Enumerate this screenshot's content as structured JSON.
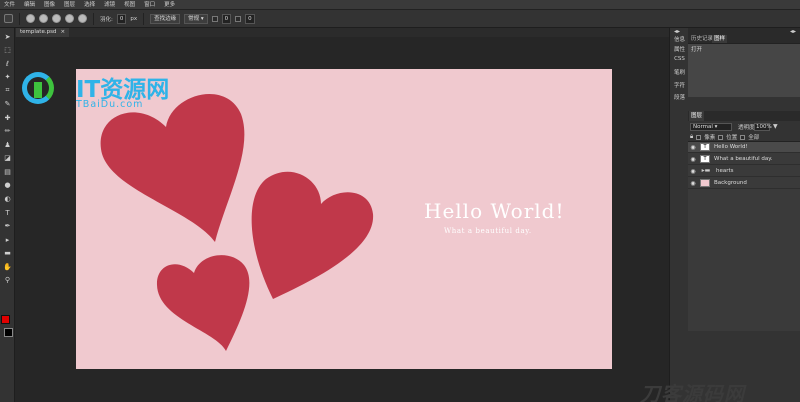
{
  "menu": [
    "文件",
    "编辑",
    "图像",
    "图层",
    "选择",
    "滤镜",
    "视图",
    "窗口",
    "更多"
  ],
  "options": {
    "feather_label": "羽化:",
    "feather_value": "0",
    "feather_unit": "px",
    "refine_button": "查找边缘",
    "style_select": "常规",
    "width_value": "0",
    "height_value": "0"
  },
  "document": {
    "tab_title": "template.psd",
    "tab_close": "×"
  },
  "canvas": {
    "background_color": "#f0c9cf",
    "heart_color": "#c0384a",
    "headline": "Hello World!",
    "subline": "What a beautiful day."
  },
  "logo": {
    "title": "IT资源网",
    "site": "TBaiDu.com"
  },
  "side_column": [
    "信息",
    "属性",
    "CSS",
    "笔刷",
    "字符",
    "段落"
  ],
  "history_panel": {
    "tabs": [
      "历史记录",
      "图样"
    ],
    "active_tab": "图样",
    "items": [
      "打开"
    ]
  },
  "layers_panel": {
    "tab": "图层",
    "blend_mode": "Normal",
    "opacity_label": "透明度:",
    "opacity_value": "100%",
    "locks": [
      "像素",
      "位置",
      "全部"
    ],
    "layers": [
      {
        "name": "Hello World!",
        "thumb": "T"
      },
      {
        "name": "What a beautiful day.",
        "thumb": "T"
      },
      {
        "name": "hearts",
        "thumb": "folder"
      },
      {
        "name": "Background",
        "thumb": "pink"
      }
    ]
  },
  "watermark": {
    "text": "刀客源码网"
  }
}
